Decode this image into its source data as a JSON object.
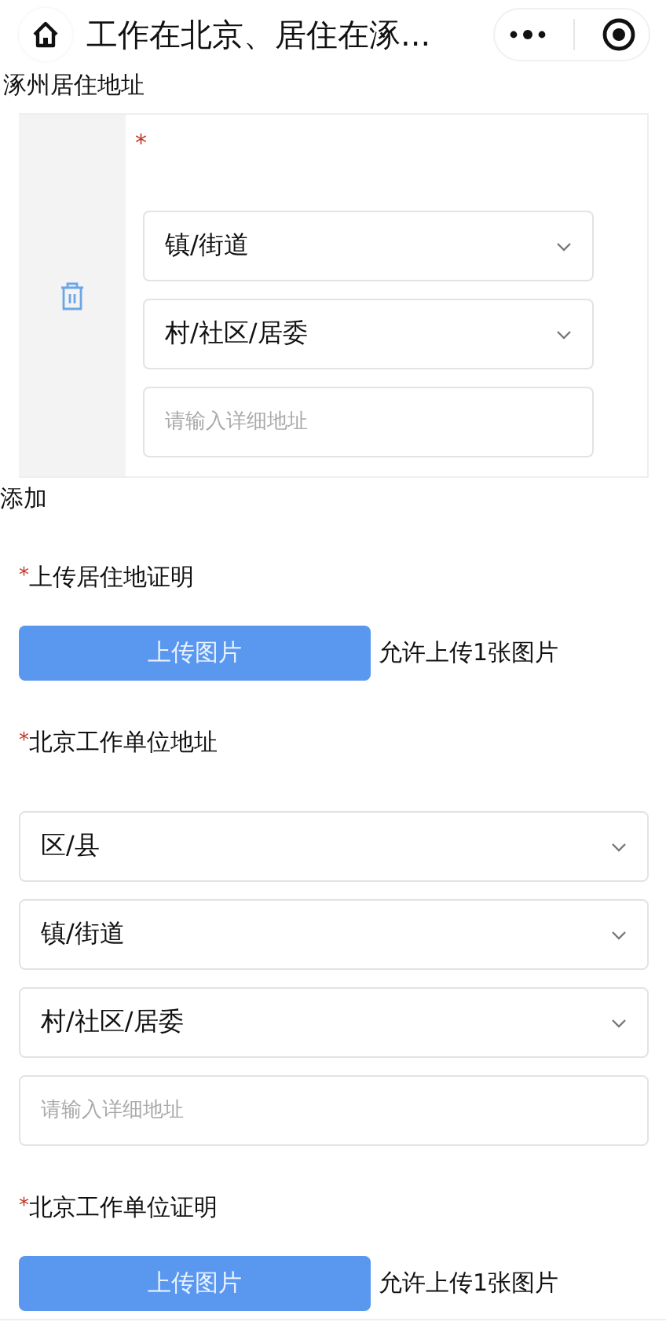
{
  "nav": {
    "title": "工作在北京、居住在涿..."
  },
  "sections": [
    {
      "kind": "address_card",
      "label": "涿州居住地址",
      "required_mark": "*",
      "selects": [
        {
          "value": "镇/街道"
        },
        {
          "value": "村/社区/居委"
        }
      ],
      "detail": {
        "placeholder": "请输入详细地址"
      }
    },
    {
      "kind": "link",
      "text": "添加"
    },
    {
      "kind": "upload",
      "required_mark": "*",
      "label": "上传居住地证明",
      "button": "上传图片",
      "hint": "允许上传1张图片"
    },
    {
      "kind": "address",
      "required_mark": "*",
      "label": "北京工作单位地址",
      "selects": [
        {
          "value": "区/县"
        },
        {
          "value": "镇/街道"
        },
        {
          "value": "村/社区/居委"
        }
      ],
      "detail": {
        "placeholder": "请输入详细地址"
      }
    },
    {
      "kind": "upload",
      "required_mark": "*",
      "label": "北京工作单位证明",
      "button": "上传图片",
      "hint": "允许上传1张图片"
    }
  ]
}
